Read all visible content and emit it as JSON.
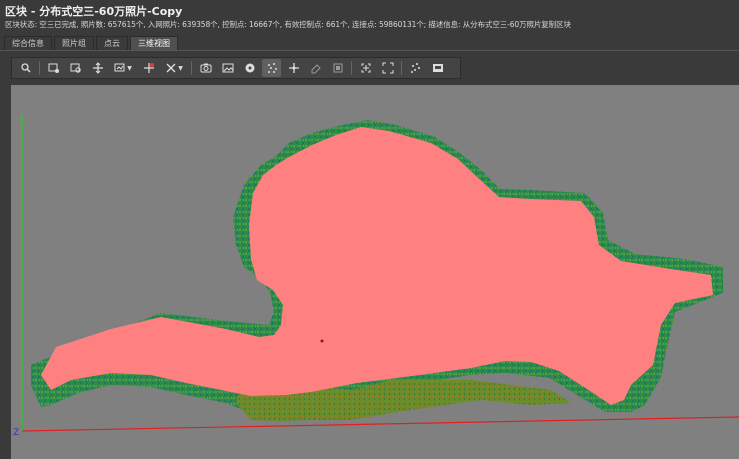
{
  "window": {
    "title": "区块 - 分布式空三-60万照片-Copy",
    "status": "区块状态: 空三已完成, 照片数: 657615个, 入网照片: 639358个, 控制点: 16667个, 有效控制点: 661个, 连接点: 59860131个; 描述信息: 从分布式空三-60万照片复制区块"
  },
  "tabs": [
    {
      "label": "综合信息"
    },
    {
      "label": "照片组"
    },
    {
      "label": "点云"
    },
    {
      "label": "三维视图",
      "active": true
    }
  ],
  "toolbar": {
    "tools": [
      "view-mode-icon",
      "select-photo-icon",
      "photo-search-icon",
      "move-icon",
      "display-dropdown-icon",
      "measure-icon",
      "axis-dropdown-icon",
      "camera-icon",
      "photo-view-icon",
      "control-point-icon",
      "tie-points-icon",
      "pan-icon",
      "eraser-icon",
      "frame-icon",
      "zoom-extent-icon",
      "fit-icon",
      "scatter-icon",
      "screenshot-icon"
    ]
  },
  "viewport": {
    "background_color": "#808080",
    "model_fill_color": "#ff8080",
    "edge_color": "#1e8a55",
    "axes": {
      "x_color": "#e02020",
      "y_color": "#28c828",
      "z_label": "Z"
    }
  }
}
